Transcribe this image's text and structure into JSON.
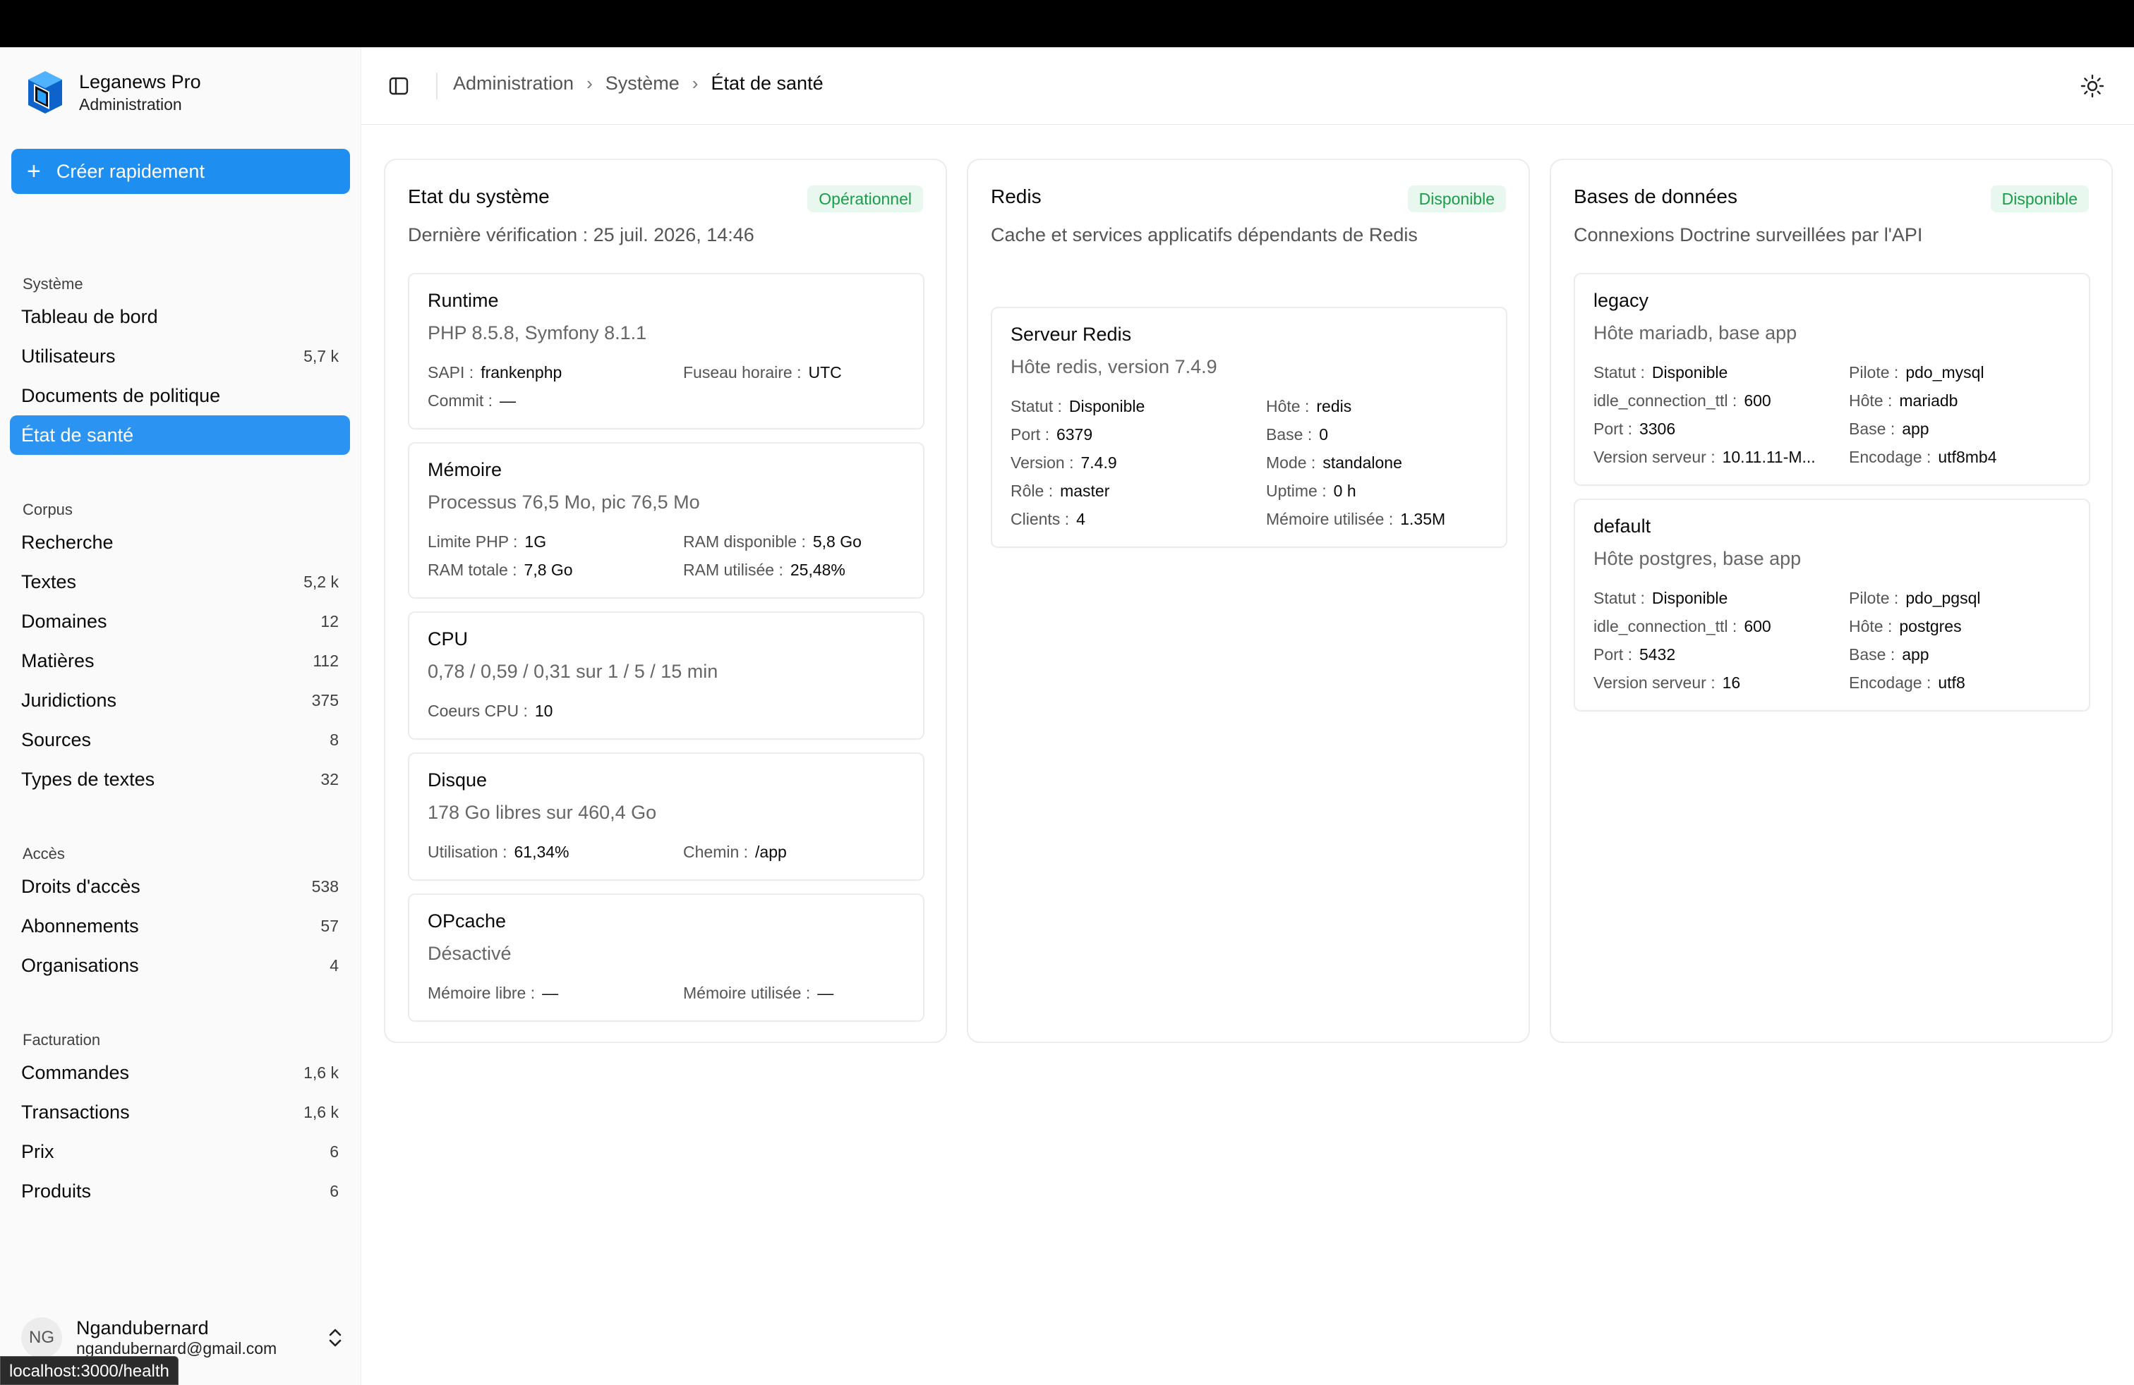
{
  "brand": {
    "title": "Leganews Pro",
    "subtitle": "Administration"
  },
  "quick_create": {
    "label": "Créer rapidement"
  },
  "nav_groups": [
    {
      "title": "Système",
      "items": [
        {
          "label": "Tableau de bord",
          "count": ""
        },
        {
          "label": "Utilisateurs",
          "count": "5,7 k"
        },
        {
          "label": "Documents de politique",
          "count": ""
        },
        {
          "label": "État de santé",
          "count": "",
          "active": true
        }
      ]
    },
    {
      "title": "Corpus",
      "items": [
        {
          "label": "Recherche",
          "count": ""
        },
        {
          "label": "Textes",
          "count": "5,2 k"
        },
        {
          "label": "Domaines",
          "count": "12"
        },
        {
          "label": "Matières",
          "count": "112"
        },
        {
          "label": "Juridictions",
          "count": "375"
        },
        {
          "label": "Sources",
          "count": "8"
        },
        {
          "label": "Types de textes",
          "count": "32"
        }
      ]
    },
    {
      "title": "Accès",
      "items": [
        {
          "label": "Droits d'accès",
          "count": "538"
        },
        {
          "label": "Abonnements",
          "count": "57"
        },
        {
          "label": "Organisations",
          "count": "4"
        }
      ]
    },
    {
      "title": "Facturation",
      "items": [
        {
          "label": "Commandes",
          "count": "1,6 k"
        },
        {
          "label": "Transactions",
          "count": "1,6 k"
        },
        {
          "label": "Prix",
          "count": "6"
        },
        {
          "label": "Produits",
          "count": "6"
        }
      ]
    }
  ],
  "user": {
    "initials": "NG",
    "name": "Ngandubernard",
    "email": "ngandubernard@gmail.com"
  },
  "status_url": "localhost:3000/health",
  "breadcrumb": [
    "Administration",
    "Système",
    "État de santé"
  ],
  "cards": {
    "system": {
      "title": "Etat du système",
      "badge": "Opérationnel",
      "description": "Dernière vérification : 25 juil. 2026, 14:46",
      "sections": {
        "runtime": {
          "title": "Runtime",
          "desc": "PHP 8.5.8, Symfony 8.1.1",
          "kv": [
            {
              "k": "SAPI :",
              "v": "frankenphp"
            },
            {
              "k": "Fuseau horaire :",
              "v": "UTC"
            },
            {
              "k": "Commit :",
              "v": "—"
            }
          ]
        },
        "memory": {
          "title": "Mémoire",
          "desc": "Processus 76,5 Mo, pic 76,5 Mo",
          "kv": [
            {
              "k": "Limite PHP :",
              "v": "1G"
            },
            {
              "k": "RAM disponible :",
              "v": "5,8 Go"
            },
            {
              "k": "RAM totale :",
              "v": "7,8 Go"
            },
            {
              "k": "RAM utilisée :",
              "v": "25,48%"
            }
          ]
        },
        "cpu": {
          "title": "CPU",
          "desc": "0,78 / 0,59 / 0,31 sur 1 / 5 / 15 min",
          "kv": [
            {
              "k": "Coeurs CPU :",
              "v": "10"
            }
          ]
        },
        "disk": {
          "title": "Disque",
          "desc": "178 Go libres sur 460,4 Go",
          "kv": [
            {
              "k": "Utilisation :",
              "v": "61,34%"
            },
            {
              "k": "Chemin :",
              "v": "/app"
            }
          ]
        },
        "opcache": {
          "title": "OPcache",
          "desc": "Désactivé",
          "kv": [
            {
              "k": "Mémoire libre :",
              "v": "—"
            },
            {
              "k": "Mémoire utilisée :",
              "v": "—"
            }
          ]
        }
      }
    },
    "redis": {
      "title": "Redis",
      "badge": "Disponible",
      "description": "Cache et services applicatifs dépendants de Redis",
      "server": {
        "title": "Serveur Redis",
        "desc": "Hôte redis, version 7.4.9",
        "kv": [
          {
            "k": "Statut :",
            "v": "Disponible"
          },
          {
            "k": "Hôte :",
            "v": "redis"
          },
          {
            "k": "Port :",
            "v": "6379"
          },
          {
            "k": "Base :",
            "v": "0"
          },
          {
            "k": "Version :",
            "v": "7.4.9"
          },
          {
            "k": "Mode :",
            "v": "standalone"
          },
          {
            "k": "Rôle :",
            "v": "master"
          },
          {
            "k": "Uptime :",
            "v": "0 h"
          },
          {
            "k": "Clients :",
            "v": "4"
          },
          {
            "k": "Mémoire utilisée :",
            "v": "1.35M"
          }
        ]
      }
    },
    "databases": {
      "title": "Bases de données",
      "badge": "Disponible",
      "description": "Connexions Doctrine surveillées par l'API",
      "legacy": {
        "title": "legacy",
        "desc": "Hôte mariadb, base app",
        "kv": [
          {
            "k": "Statut :",
            "v": "Disponible"
          },
          {
            "k": "Pilote :",
            "v": "pdo_mysql"
          },
          {
            "k": "idle_connection_ttl :",
            "v": "600"
          },
          {
            "k": "Hôte :",
            "v": "mariadb"
          },
          {
            "k": "Port :",
            "v": "3306"
          },
          {
            "k": "Base :",
            "v": "app"
          },
          {
            "k": "Version serveur :",
            "v": "10.11.11-M..."
          },
          {
            "k": "Encodage :",
            "v": "utf8mb4"
          }
        ]
      },
      "default": {
        "title": "default",
        "desc": "Hôte postgres, base app",
        "kv": [
          {
            "k": "Statut :",
            "v": "Disponible"
          },
          {
            "k": "Pilote :",
            "v": "pdo_pgsql"
          },
          {
            "k": "idle_connection_ttl :",
            "v": "600"
          },
          {
            "k": "Hôte :",
            "v": "postgres"
          },
          {
            "k": "Port :",
            "v": "5432"
          },
          {
            "k": "Base :",
            "v": "app"
          },
          {
            "k": "Version serveur :",
            "v": "16"
          },
          {
            "k": "Encodage :",
            "v": "utf8"
          }
        ]
      }
    }
  },
  "colors": {
    "accent": "#1f8ef1",
    "badge_bg": "#e9f8ee",
    "badge_text": "#1a9d4a"
  }
}
